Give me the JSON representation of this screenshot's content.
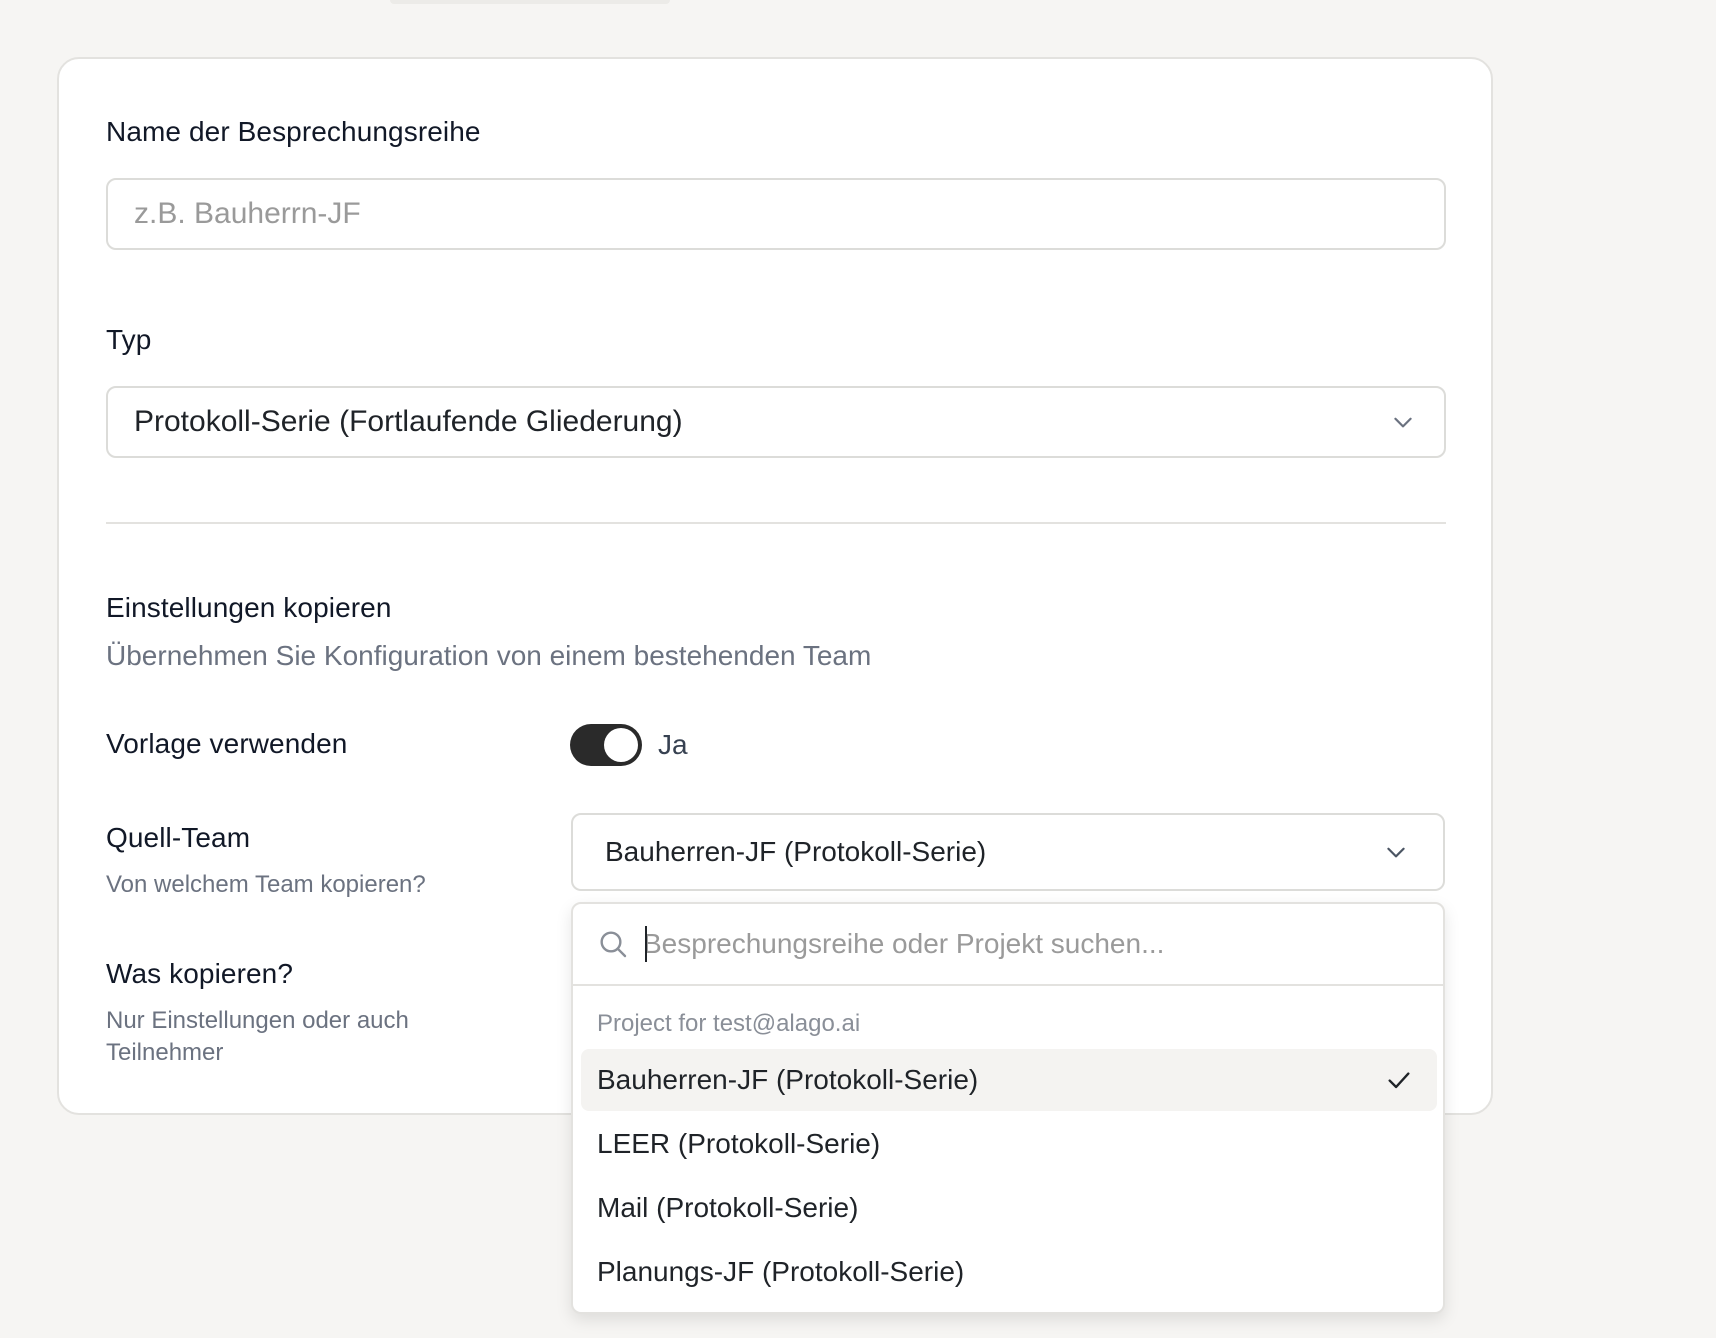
{
  "form": {
    "name_label": "Name der Besprechungsreihe",
    "name_placeholder": "z.B. Bauherrn-JF",
    "type_label": "Typ",
    "type_value": "Protokoll-Serie (Fortlaufende Gliederung)",
    "copy_section": {
      "title": "Einstellungen kopieren",
      "subtitle": "Übernehmen Sie Konfiguration von einem bestehenden Team"
    },
    "use_template": {
      "label": "Vorlage verwenden",
      "toggle_state_label": "Ja",
      "enabled": true
    },
    "source_team": {
      "label": "Quell-Team",
      "helper": "Von welchem Team kopieren?",
      "value": "Bauherren-JF (Protokoll-Serie)"
    },
    "what_copy": {
      "label": "Was kopieren?",
      "helper_line1": "Nur Einstellungen oder auch",
      "helper_line2": "Teilnehmer"
    }
  },
  "dropdown": {
    "search_placeholder": "Besprechungsreihe oder Projekt suchen...",
    "group_label": "Project for test@alago.ai",
    "options": [
      {
        "label": "Bauherren-JF (Protokoll-Serie)",
        "selected": true
      },
      {
        "label": "LEER (Protokoll-Serie)",
        "selected": false
      },
      {
        "label": "Mail (Protokoll-Serie)",
        "selected": false
      },
      {
        "label": "Planungs-JF (Protokoll-Serie)",
        "selected": false
      }
    ]
  },
  "icons": {
    "select_chevron": "chevron-down-icon",
    "search": "search-icon",
    "selected_check": "check-icon"
  },
  "colors": {
    "toggle_on": "#2a2a2a",
    "selected_row": "#f4f3f1",
    "muted_text": "#6b7280"
  }
}
